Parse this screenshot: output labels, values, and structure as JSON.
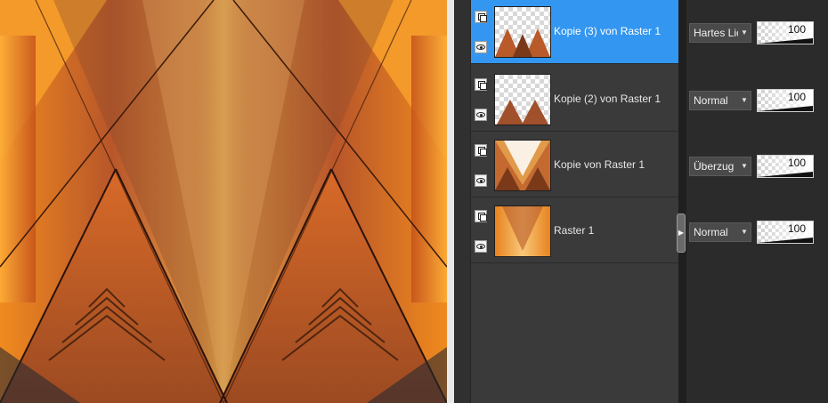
{
  "canvas": {
    "description_name": "artwork-canvas"
  },
  "layers": [
    {
      "name": "Kopie (3) von Raster 1",
      "blend_mode": "Hartes Licht",
      "opacity": "100",
      "selected": true,
      "visible": true
    },
    {
      "name": "Kopie (2) von Raster 1",
      "blend_mode": "Normal",
      "opacity": "100",
      "selected": false,
      "visible": true
    },
    {
      "name": "Kopie von Raster 1",
      "blend_mode": "Überzug",
      "opacity": "100",
      "selected": false,
      "visible": true
    },
    {
      "name": "Raster 1",
      "blend_mode": "Normal",
      "opacity": "100",
      "selected": false,
      "visible": true
    }
  ],
  "icons": {
    "group": "layer-group-icon",
    "visibility": "eye-icon",
    "dropdown": "chevron-down-icon",
    "splitter": "chevron-right-icon"
  },
  "colors": {
    "selected_row": "#3396f0",
    "panel_bg": "#3a3a3a",
    "art_orange": "#e8821e",
    "art_dark": "#5a2a14"
  }
}
